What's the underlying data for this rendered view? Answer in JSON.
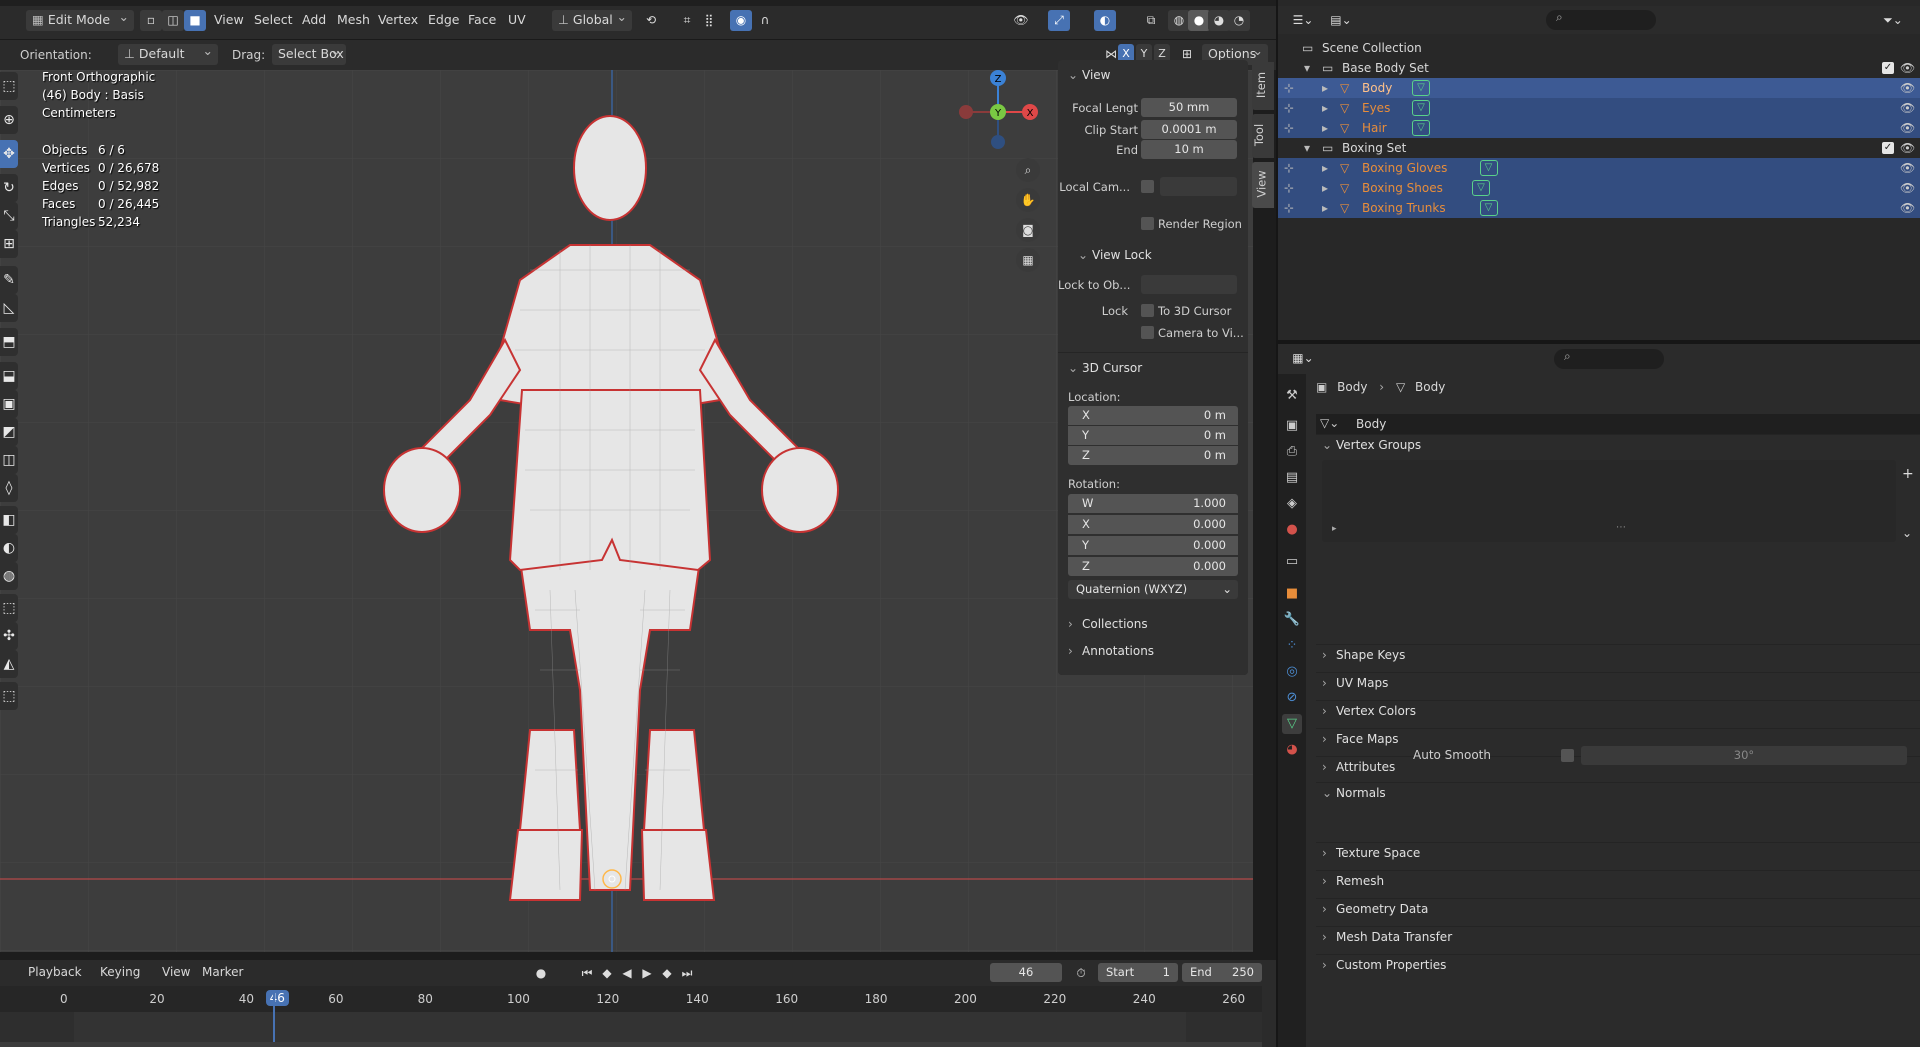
{
  "header": {
    "mode": "Edit Mode",
    "menus": [
      "View",
      "Select",
      "Add",
      "Mesh",
      "Vertex",
      "Edge",
      "Face",
      "UV"
    ],
    "transform_orientation": "Global",
    "options_label": "Options"
  },
  "tool_settings": {
    "orientation_label": "Orientation:",
    "orientation_value": "Default",
    "drag_label": "Drag:",
    "drag_value": "Select Box"
  },
  "viewport": {
    "view_name": "Front Orthographic",
    "object_info": "(46) Body : Basis",
    "units": "Centimeters",
    "stats": [
      {
        "label": "Objects",
        "value": "6 / 6"
      },
      {
        "label": "Vertices",
        "value": "0 / 26,678"
      },
      {
        "label": "Edges",
        "value": "0 / 52,982"
      },
      {
        "label": "Faces",
        "value": "0 / 26,445"
      },
      {
        "label": "Triangles",
        "value": "52,234"
      }
    ],
    "gizmo_axes": [
      "Z",
      "Y",
      "X"
    ]
  },
  "sidebar": {
    "tabs": [
      "Item",
      "Tool",
      "View"
    ],
    "view_section": "View",
    "focal_length_label": "Focal Lengt",
    "focal_length_value": "50 mm",
    "clip_start_label": "Clip Start",
    "clip_start_value": "0.0001 m",
    "end_label": "End",
    "end_value": "10 m",
    "local_camera_label": "Local Cam...",
    "render_region_label": "Render Region",
    "view_lock_section": "View Lock",
    "lock_to_object_label": "Lock to Ob...",
    "lock_label": "Lock",
    "to_3d_cursor_label": "To 3D Cursor",
    "camera_to_view_label": "Camera to Vi...",
    "cursor_section": "3D Cursor",
    "location_label": "Location:",
    "location": [
      {
        "axis": "X",
        "value": "0 m"
      },
      {
        "axis": "Y",
        "value": "0 m"
      },
      {
        "axis": "Z",
        "value": "0 m"
      }
    ],
    "rotation_label": "Rotation:",
    "rotation": [
      {
        "axis": "W",
        "value": "1.000"
      },
      {
        "axis": "X",
        "value": "0.000"
      },
      {
        "axis": "Y",
        "value": "0.000"
      },
      {
        "axis": "Z",
        "value": "0.000"
      }
    ],
    "rotation_mode": "Quaternion (WXYZ)",
    "collections_section": "Collections",
    "annotations_section": "Annotations"
  },
  "timeline": {
    "menus": [
      "Playback",
      "Keying",
      "View",
      "Marker"
    ],
    "current_frame": "46",
    "start_label": "Start",
    "start_value": "1",
    "end_label": "End",
    "end_value": "250",
    "ruler_ticks": [
      "0",
      "20",
      "40",
      "46",
      "60",
      "80",
      "100",
      "120",
      "140",
      "160",
      "180",
      "200",
      "220",
      "240",
      "260"
    ]
  },
  "outliner": {
    "root": "Scene Collection",
    "collections": [
      {
        "name": "Base Body Set",
        "objects": [
          "Body",
          "Eyes",
          "Hair"
        ]
      },
      {
        "name": "Boxing Set",
        "objects": [
          "Boxing Gloves",
          "Boxing Shoes",
          "Boxing Trunks"
        ]
      }
    ]
  },
  "properties": {
    "breadcrumb_object": "Body",
    "breadcrumb_data": "Body",
    "data_name": "Body",
    "sections": [
      "Vertex Groups",
      "Shape Keys",
      "UV Maps",
      "Vertex Colors",
      "Face Maps",
      "Attributes",
      "Normals",
      "Texture Space",
      "Remesh",
      "Geometry Data",
      "Mesh Data Transfer",
      "Custom Properties"
    ],
    "auto_smooth_label": "Auto Smooth",
    "auto_smooth_angle": "30°"
  },
  "colors": {
    "accent": "#4772b3",
    "selection": "#334d80",
    "object_orange": "#e88d3a",
    "edge_red": "#d33a3a"
  }
}
